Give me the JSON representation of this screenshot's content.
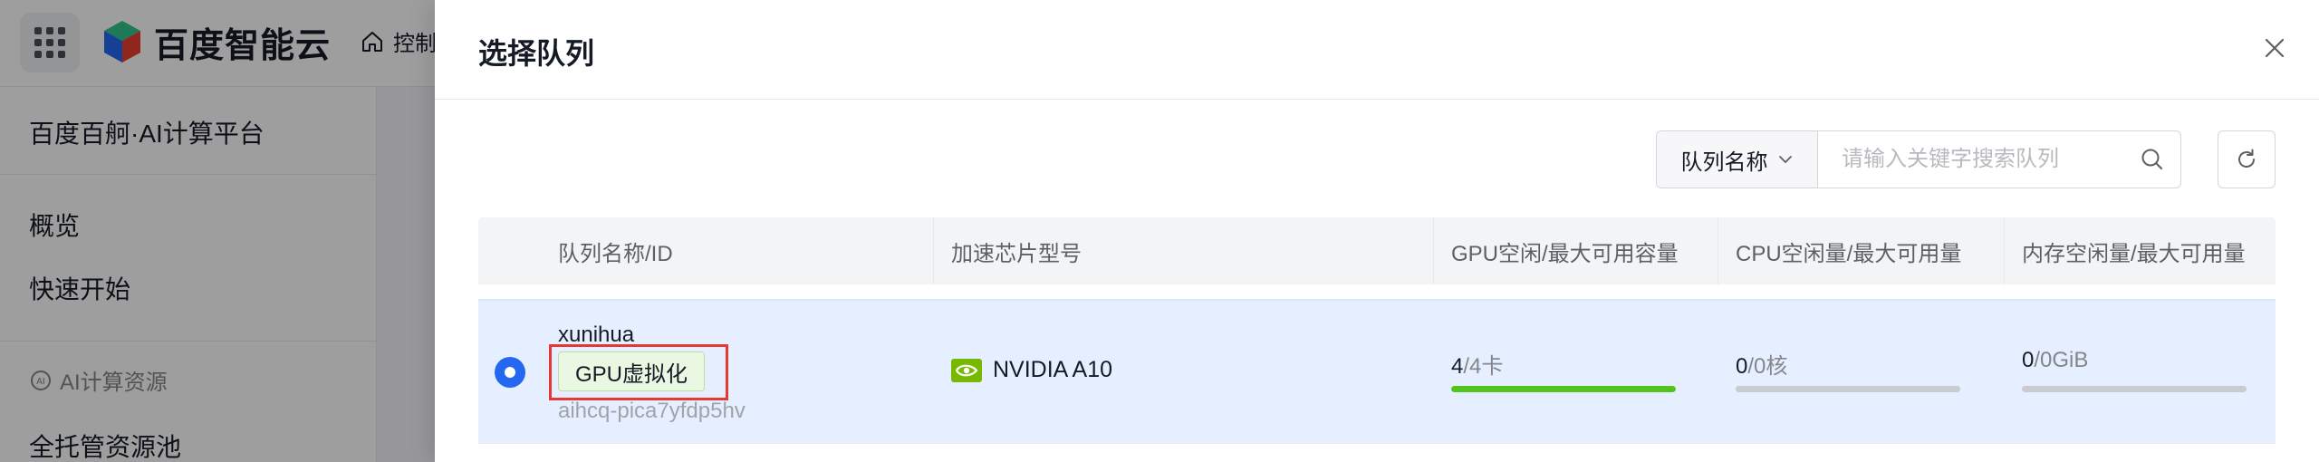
{
  "topbar": {
    "logo_text": "百度智能云",
    "console_label": "控制"
  },
  "sidebar": {
    "title": "百度百舸·AI计算平台",
    "items": [
      {
        "label": "概览"
      },
      {
        "label": "快速开始"
      }
    ],
    "group_label": "AI计算资源",
    "group_items": [
      {
        "label": "全托管资源池"
      }
    ]
  },
  "drawer": {
    "title": "选择队列",
    "search": {
      "field_label": "队列名称",
      "placeholder": "请输入关键字搜索队列"
    },
    "table": {
      "headers": [
        "队列名称/ID",
        "加速芯片型号",
        "GPU空闲/最大可用容量",
        "CPU空闲量/最大可用量",
        "内存空闲量/最大可用量"
      ],
      "rows": [
        {
          "selected": true,
          "name": "xunihua",
          "tag": "GPU虚拟化",
          "id": "aihcq-pica7yfdp5hv",
          "chip": "NVIDIA A10",
          "gpu_free": "4",
          "gpu_max": "4卡",
          "gpu_ratio": 1.0,
          "cpu_free": "0",
          "cpu_max": "0核",
          "cpu_ratio": 0,
          "mem_free": "0",
          "mem_max": "0GiB",
          "mem_ratio": 0
        }
      ]
    }
  },
  "colors": {
    "primary": "#2468f2",
    "selected_row_bg": "#e6efff",
    "capacity_green": "#52c41a",
    "highlight_red": "#e53a34",
    "tag_green_bg": "#eaf7e2"
  }
}
